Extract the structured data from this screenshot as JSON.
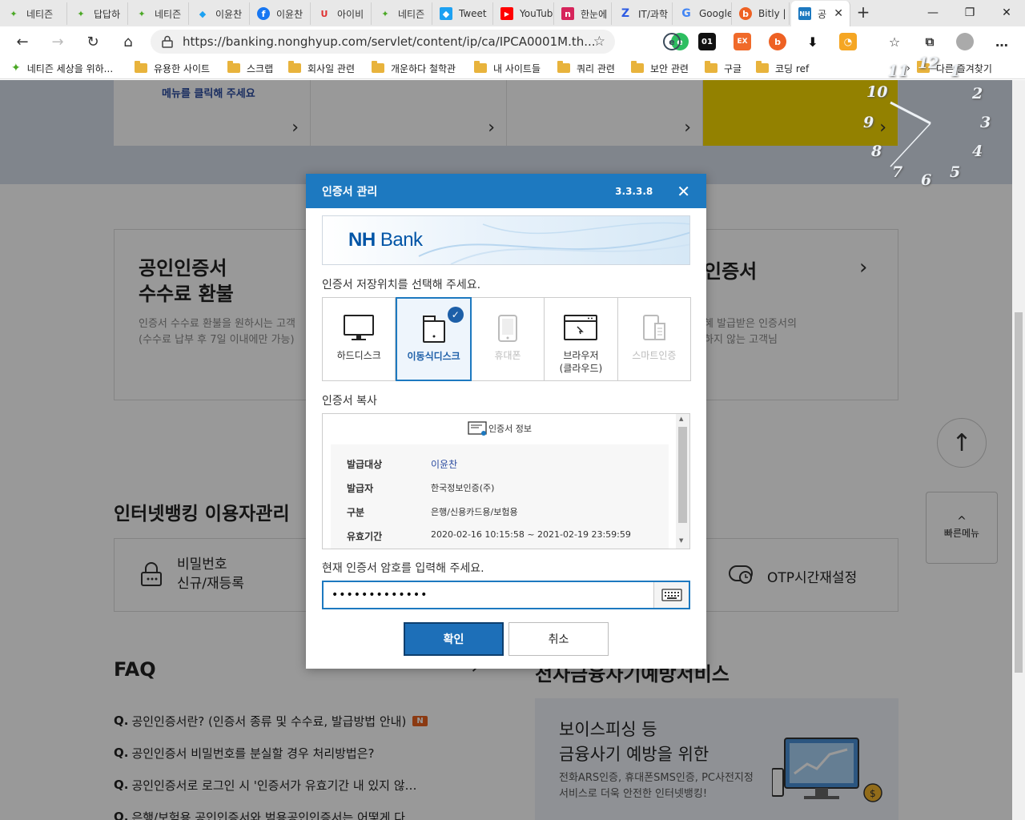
{
  "browser": {
    "tabs": [
      {
        "label": "네티즌",
        "icon": "sprout-icon",
        "color": "#4aa824"
      },
      {
        "label": "답답하",
        "icon": "sprout-icon",
        "color": "#4aa824"
      },
      {
        "label": "네티즌",
        "icon": "sprout-icon",
        "color": "#4aa824"
      },
      {
        "label": "이윤찬",
        "icon": "twitter-icon",
        "color": "#1da1f2"
      },
      {
        "label": "이윤찬",
        "icon": "facebook-icon",
        "color": "#1877f2"
      },
      {
        "label": "아이비",
        "icon": "u-icon",
        "color": "#e03131"
      },
      {
        "label": "네티즌",
        "icon": "sprout-icon",
        "color": "#4aa824"
      },
      {
        "label": "Tweet",
        "icon": "twitter-icon",
        "color": "#1da1f2"
      },
      {
        "label": "YouTube",
        "icon": "youtube-icon",
        "color": "#ff0000"
      },
      {
        "label": "한눈에",
        "icon": "n-icon",
        "color": "#d6245b"
      },
      {
        "label": "IT/과학",
        "icon": "z-icon",
        "color": "#2d5be3"
      },
      {
        "label": "Google",
        "icon": "google-icon",
        "color": "#4285f4"
      },
      {
        "label": "Bitly | A",
        "icon": "bitly-icon",
        "color": "#ee6123"
      },
      {
        "label": "공",
        "icon": "nh-icon",
        "color": "#1d79c0"
      }
    ],
    "url": "https://banking.nonghyup.com/servlet/content/ip/ca/IPCA0001M.th...",
    "bookmarks": [
      {
        "label": "네티즌 세상을 위하...",
        "type": "site"
      },
      {
        "label": "유용한 사이트",
        "type": "folder"
      },
      {
        "label": "스크랩",
        "type": "folder"
      },
      {
        "label": "회사일 관련",
        "type": "folder"
      },
      {
        "label": "개운하다 철학관",
        "type": "folder"
      },
      {
        "label": "내 사이트들",
        "type": "folder"
      },
      {
        "label": "쿼리 관련",
        "type": "folder"
      },
      {
        "label": "보안 관련",
        "type": "folder"
      },
      {
        "label": "구글",
        "type": "folder"
      },
      {
        "label": "코딩 ref",
        "type": "folder"
      }
    ],
    "other_bookmarks": "다른 즐겨찾기",
    "extensions": [
      "01",
      "EX"
    ]
  },
  "page": {
    "top_menu_hint": "메뉴를 클릭해 주세요",
    "refund": {
      "title_line1": "공인인증서",
      "title_line2": "수수료 환불",
      "desc_line1": "인증서 수수료 환불을 원하시는 고객",
      "desc_line2": "(수수료 납부 후 7일 이내에만 가능)"
    },
    "right_card": {
      "title": "인증서",
      "desc_line1": "혜 발급받은 인증서의",
      "desc_line2": "하지 않는 고객님"
    },
    "user_mgmt": {
      "title": "인터넷뱅킹 이용자관리",
      "pw_line1": "비밀번호",
      "pw_line2": "신규/재등록",
      "otp": "OTP시간재설정"
    },
    "quick_menu": "빠른메뉴",
    "faq": {
      "title": "FAQ",
      "items": [
        {
          "q": "Q.",
          "text": "공인인증서란? (인증서 종류 및 수수료, 발급방법 안내)",
          "badge": "N"
        },
        {
          "q": "Q.",
          "text": "공인인증서 비밀번호를 분실할 경우 처리방법은?",
          "badge": ""
        },
        {
          "q": "Q.",
          "text": "공인인증서로 로그인 시 '인증서가 유효기간 내 있지 않…",
          "badge": ""
        },
        {
          "q": "Q.",
          "text": "은행/보험용 공인인증서와 범용공인인증서는 어떻게 다…",
          "badge": ""
        }
      ]
    },
    "fraud": {
      "title": "전자금융사기예방서비스",
      "line1": "보이스피싱 등",
      "line2": "금융사기 예방을 위한",
      "desc_line1": "전화ARS인증, 휴대폰SMS인증, PC사전지정",
      "desc_line2": "서비스로 더욱 안전한 인터넷뱅킹!"
    }
  },
  "dialog": {
    "title": "인증서 관리",
    "version": "3.3.3.8",
    "banner_logo_nh": "NH",
    "banner_logo_bank": "Bank",
    "storage_label": "인증서 저장위치를 선택해 주세요.",
    "media": [
      {
        "label": "하드디스크",
        "label2": "",
        "state": "normal",
        "icon": "monitor-icon"
      },
      {
        "label": "이동식디스크",
        "label2": "",
        "state": "selected",
        "icon": "usb-disk-icon"
      },
      {
        "label": "휴대폰",
        "label2": "",
        "state": "disabled",
        "icon": "phone-icon"
      },
      {
        "label": "브라우저",
        "label2": "(클라우드)",
        "state": "normal",
        "icon": "browser-icon"
      },
      {
        "label": "스마트인증",
        "label2": "",
        "state": "disabled",
        "icon": "smart-cert-icon"
      }
    ],
    "copy_label": "인증서 복사",
    "cert_info_title": "인증서 정보",
    "cert_rows": [
      {
        "key": "발급대상",
        "value": "이윤찬"
      },
      {
        "key": "발급자",
        "value": "한국정보인증(주)"
      },
      {
        "key": "구분",
        "value": "은행/신용카드용/보험용"
      },
      {
        "key": "유효기간",
        "value": "2020-02-16 10:15:58 ~ 2021-02-19 23:59:59"
      }
    ],
    "password_label": "현재 인증서 암호를 입력해 주세요.",
    "password_value": "•••••••••••••",
    "ok_label": "확인",
    "cancel_label": "취소"
  },
  "clock": {
    "numbers": [
      "12",
      "1",
      "2",
      "3",
      "4",
      "5",
      "6",
      "7",
      "8",
      "9",
      "10",
      "11"
    ]
  },
  "colors": {
    "accent": "#1d79c0",
    "ok_button": "#1d6fb8",
    "overlay": "rgba(0,0,0,0.40)",
    "yellow_card": "#f5d800"
  }
}
